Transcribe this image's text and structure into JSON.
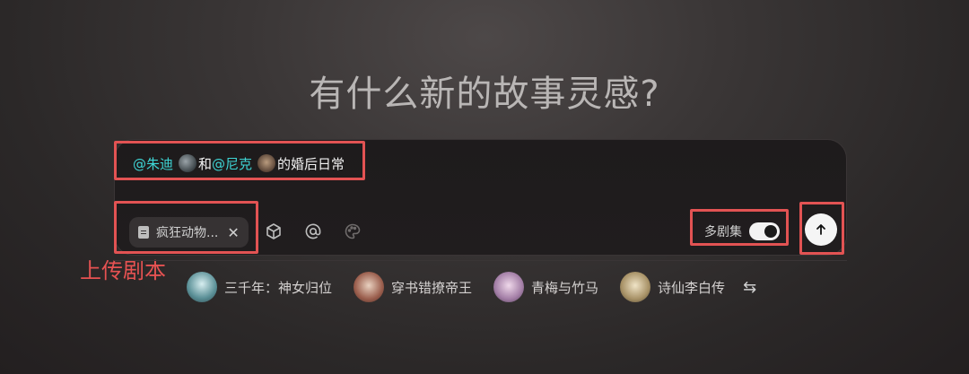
{
  "headline": "有什么新的故事灵感?",
  "prompt": {
    "mention1": "@朱迪",
    "connector": "和",
    "mention2": "@尼克",
    "rest": "的婚后日常"
  },
  "file_chip": {
    "label": "疯狂动物...",
    "close": "✕"
  },
  "toolbar": {
    "multi_episode_label": "多剧集",
    "multi_episode_enabled": true
  },
  "annotation": {
    "upload_label": "上传剧本",
    "color": "#e25353"
  },
  "suggestions": [
    {
      "label": "三千年：神女归位"
    },
    {
      "label": "穿书错撩帝王"
    },
    {
      "label": "青梅与竹马"
    },
    {
      "label": "诗仙李白传"
    }
  ],
  "colors": {
    "mention": "#3ed6d6",
    "send_button": "#f5f5f5"
  },
  "icons": {
    "cube": "cube-icon",
    "at": "at-icon",
    "palette": "palette-icon",
    "send": "arrow-up-icon",
    "shuffle": "shuffle-icon"
  }
}
